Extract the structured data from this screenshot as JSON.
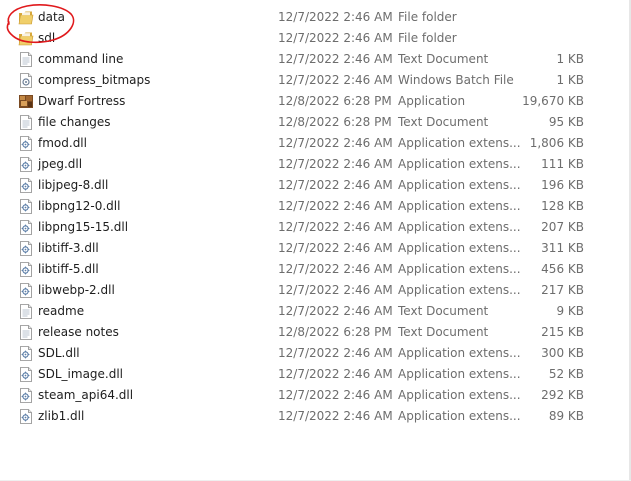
{
  "files": [
    {
      "name": "data",
      "date": "12/7/2022 2:46 AM",
      "type": "File folder",
      "size": "",
      "icon": "folder-icon"
    },
    {
      "name": "sdl",
      "date": "12/7/2022 2:46 AM",
      "type": "File folder",
      "size": "",
      "icon": "folder-icon"
    },
    {
      "name": "command line",
      "date": "12/7/2022 2:46 AM",
      "type": "Text Document",
      "size": "1 KB",
      "icon": "text-document-icon"
    },
    {
      "name": "compress_bitmaps",
      "date": "12/7/2022 2:46 AM",
      "type": "Windows Batch File",
      "size": "1 KB",
      "icon": "batch-file-icon"
    },
    {
      "name": "Dwarf Fortress",
      "date": "12/8/2022 6:28 PM",
      "type": "Application",
      "size": "19,670 KB",
      "icon": "application-icon"
    },
    {
      "name": "file changes",
      "date": "12/8/2022 6:28 PM",
      "type": "Text Document",
      "size": "95 KB",
      "icon": "text-document-icon"
    },
    {
      "name": "fmod.dll",
      "date": "12/7/2022 2:46 AM",
      "type": "Application extens...",
      "size": "1,806 KB",
      "icon": "dll-icon"
    },
    {
      "name": "jpeg.dll",
      "date": "12/7/2022 2:46 AM",
      "type": "Application extens...",
      "size": "111 KB",
      "icon": "dll-icon"
    },
    {
      "name": "libjpeg-8.dll",
      "date": "12/7/2022 2:46 AM",
      "type": "Application extens...",
      "size": "196 KB",
      "icon": "dll-icon"
    },
    {
      "name": "libpng12-0.dll",
      "date": "12/7/2022 2:46 AM",
      "type": "Application extens...",
      "size": "128 KB",
      "icon": "dll-icon"
    },
    {
      "name": "libpng15-15.dll",
      "date": "12/7/2022 2:46 AM",
      "type": "Application extens...",
      "size": "207 KB",
      "icon": "dll-icon"
    },
    {
      "name": "libtiff-3.dll",
      "date": "12/7/2022 2:46 AM",
      "type": "Application extens...",
      "size": "311 KB",
      "icon": "dll-icon"
    },
    {
      "name": "libtiff-5.dll",
      "date": "12/7/2022 2:46 AM",
      "type": "Application extens...",
      "size": "456 KB",
      "icon": "dll-icon"
    },
    {
      "name": "libwebp-2.dll",
      "date": "12/7/2022 2:46 AM",
      "type": "Application extens...",
      "size": "217 KB",
      "icon": "dll-icon"
    },
    {
      "name": "readme",
      "date": "12/7/2022 2:46 AM",
      "type": "Text Document",
      "size": "9 KB",
      "icon": "text-document-icon"
    },
    {
      "name": "release notes",
      "date": "12/8/2022 6:28 PM",
      "type": "Text Document",
      "size": "215 KB",
      "icon": "text-document-icon"
    },
    {
      "name": "SDL.dll",
      "date": "12/7/2022 2:46 AM",
      "type": "Application extens...",
      "size": "300 KB",
      "icon": "dll-icon"
    },
    {
      "name": "SDL_image.dll",
      "date": "12/7/2022 2:46 AM",
      "type": "Application extens...",
      "size": "52 KB",
      "icon": "dll-icon"
    },
    {
      "name": "steam_api64.dll",
      "date": "12/7/2022 2:46 AM",
      "type": "Application extens...",
      "size": "292 KB",
      "icon": "dll-icon"
    },
    {
      "name": "zlib1.dll",
      "date": "12/7/2022 2:46 AM",
      "type": "Application extens...",
      "size": "89 KB",
      "icon": "dll-icon"
    }
  ],
  "colors": {
    "name_text": "#1e1e1e",
    "detail_text": "#6d6d6d",
    "folder": "#e8c25a",
    "annotation_circle": "#e0191c"
  }
}
